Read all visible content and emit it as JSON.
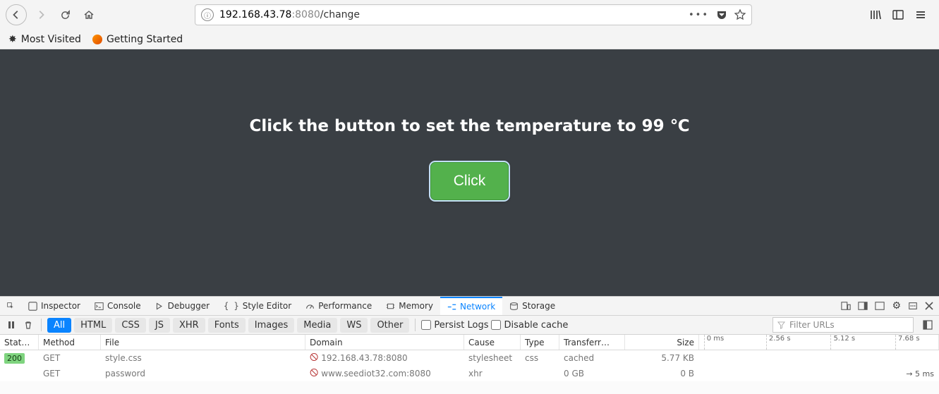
{
  "browser": {
    "url": {
      "host": "192.168.43.78",
      "port": ":8080",
      "path": "/change"
    }
  },
  "bookmarks": {
    "most_visited": "Most Visited",
    "getting_started": "Getting Started"
  },
  "page": {
    "heading": "Click the button to set the temperature to 99 ℃",
    "button_label": "Click"
  },
  "devtools": {
    "tabs": {
      "inspector": "Inspector",
      "console": "Console",
      "debugger": "Debugger",
      "style_editor": "Style Editor",
      "performance": "Performance",
      "memory": "Memory",
      "network": "Network",
      "storage": "Storage"
    },
    "filters": {
      "all": "All",
      "html": "HTML",
      "css": "CSS",
      "js": "JS",
      "xhr": "XHR",
      "fonts": "Fonts",
      "images": "Images",
      "media": "Media",
      "ws": "WS",
      "other": "Other",
      "persist_logs": "Persist Logs",
      "disable_cache": "Disable cache",
      "filter_placeholder": "Filter URLs"
    },
    "columns": {
      "status": "Stat…",
      "method": "Method",
      "file": "File",
      "domain": "Domain",
      "cause": "Cause",
      "type": "Type",
      "transferred": "Transferr…",
      "size": "Size",
      "t0": "0 ms",
      "t1": "2.56 s",
      "t2": "5.12 s",
      "t3": "7.68 s",
      "rarrow": "→ 5 ms"
    },
    "rows": [
      {
        "status": "200",
        "method": "GET",
        "file": "style.css",
        "domain": "192.168.43.78:8080",
        "cause": "stylesheet",
        "type": "css",
        "transferred": "cached",
        "size": "5.77 KB"
      },
      {
        "status": "",
        "method": "GET",
        "file": "password",
        "domain": "www.seediot32.com:8080",
        "cause": "xhr",
        "type": "",
        "transferred": "0 GB",
        "size": "0 B"
      }
    ]
  }
}
